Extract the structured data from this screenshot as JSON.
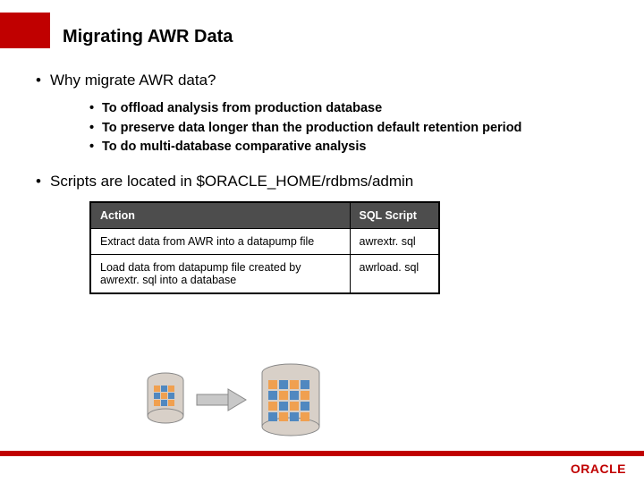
{
  "title": "Migrating AWR Data",
  "bullets": {
    "why": "Why migrate AWR data?",
    "reasons": [
      "To offload analysis from production database",
      "To preserve data longer than the production default retention period",
      "To do multi-database comparative analysis"
    ],
    "scripts_location": "Scripts are located in $ORACLE_HOME/rdbms/admin"
  },
  "table": {
    "headers": {
      "action": "Action",
      "script": "SQL Script"
    },
    "rows": [
      {
        "action": "Extract data from AWR into a datapump file",
        "script": "awrextr. sql"
      },
      {
        "action": "Load data from datapump file created by awrextr. sql into a database",
        "script": "awrload. sql"
      }
    ]
  },
  "logo": "ORACLE"
}
